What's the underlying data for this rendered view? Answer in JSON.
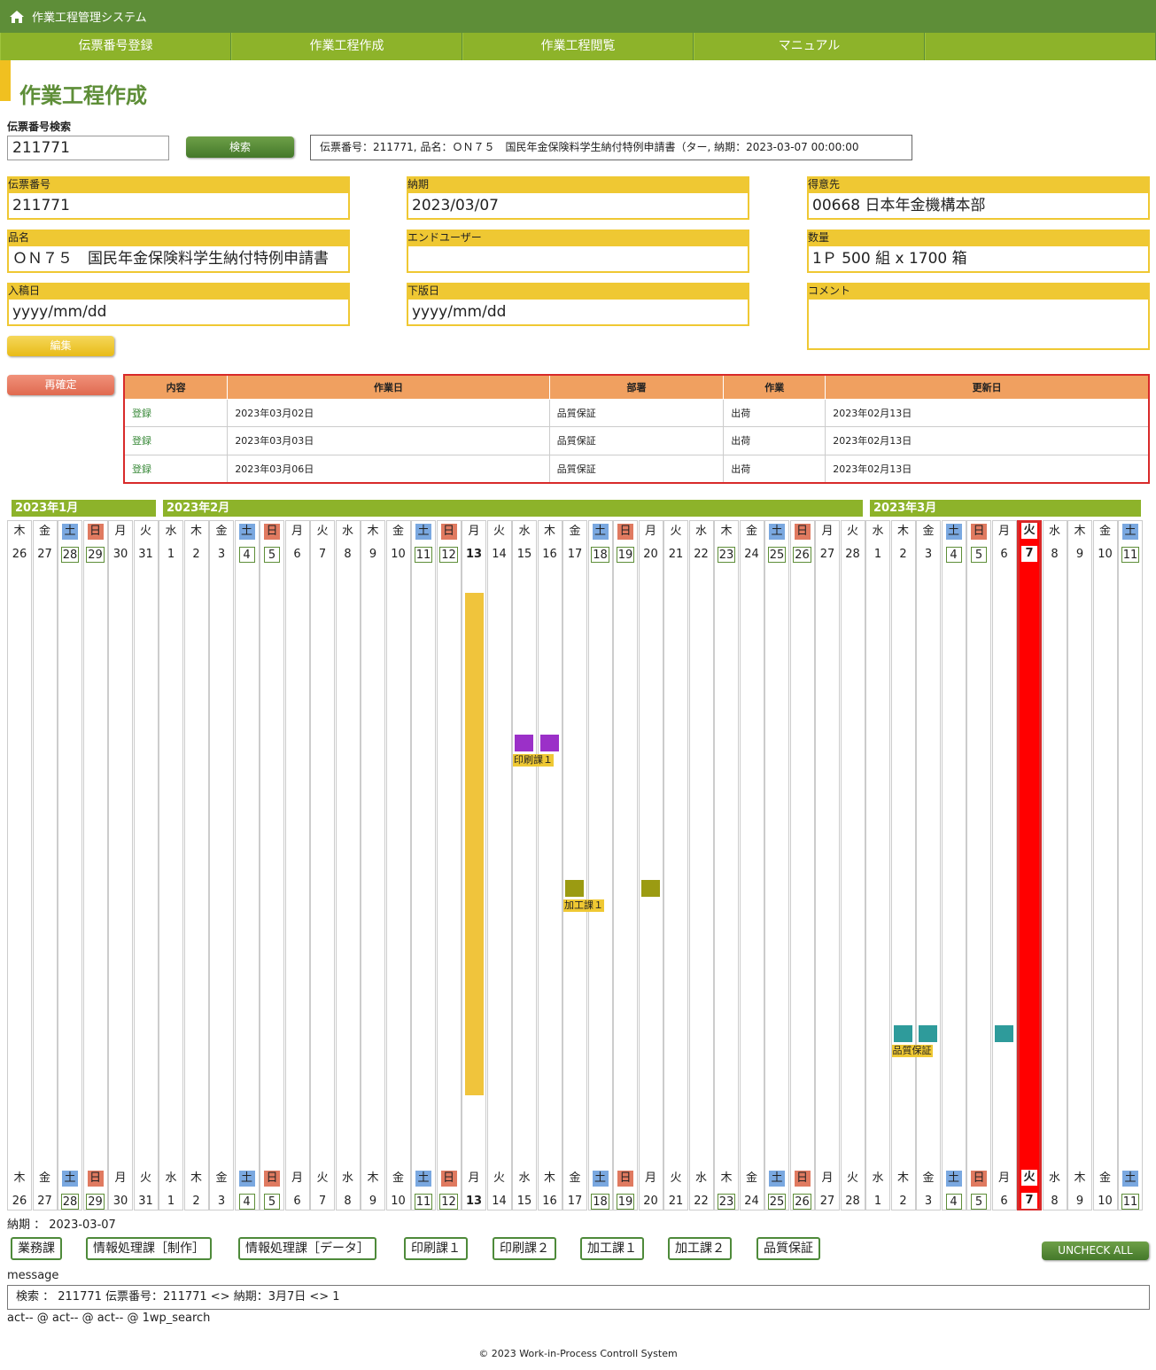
{
  "app": {
    "title": "作業工程管理システム"
  },
  "nav": [
    "伝票番号登録",
    "作業工程作成",
    "作業工程閲覧",
    "マニュアル",
    ""
  ],
  "page": {
    "title": "作業工程作成"
  },
  "search": {
    "label": "伝票番号検索",
    "value": "211771",
    "button": "検索",
    "result": "伝票番号：211771, 品名：ＯＮ７５　国民年金保険料学生納付特例申請書（ター, 納期：2023-03-07 00:00:00"
  },
  "form": {
    "slip_no": {
      "label": "伝票番号",
      "value": "211771"
    },
    "due": {
      "label": "納期",
      "value": "2023/03/07"
    },
    "customer": {
      "label": "得意先",
      "value": "00668 日本年金機構本部"
    },
    "product": {
      "label": "品名",
      "value": "ＯＮ７５　国民年金保険料学生納付特例申請書"
    },
    "end_user": {
      "label": "エンドユーザー",
      "value": ""
    },
    "quantity": {
      "label": "数量",
      "value": "1Ｐ 500 組 x 1700 箱"
    },
    "entry_date": {
      "label": "入稿日",
      "value": "yyyy/mm/dd"
    },
    "plate_date": {
      "label": "下版日",
      "value": "yyyy/mm/dd"
    },
    "comment": {
      "label": "コメント",
      "value": ""
    }
  },
  "buttons": {
    "edit": "編集",
    "reconfirm": "再確定",
    "uncheck_all": "UNCHECK ALL"
  },
  "history": {
    "headers": [
      "内容",
      "作業日",
      "部署",
      "作業",
      "更新日"
    ],
    "rows": [
      [
        "登録",
        "2023年03月02日",
        "品質保証",
        "出荷",
        "2023年02月13日"
      ],
      [
        "登録",
        "2023年03月03日",
        "品質保証",
        "出荷",
        "2023年02月13日"
      ],
      [
        "登録",
        "2023年03月06日",
        "品質保証",
        "出荷",
        "2023年02月13日"
      ]
    ]
  },
  "calendar": {
    "months": [
      {
        "label": "2023年1月",
        "first_day": 0,
        "days": 6
      },
      {
        "label": "2023年2月",
        "first_day": 6,
        "days": 28
      },
      {
        "label": "2023年3月",
        "first_day": 34,
        "days": 11
      }
    ],
    "days": [
      {
        "wd": "木",
        "d": "26"
      },
      {
        "wd": "金",
        "d": "27"
      },
      {
        "wd": "土",
        "d": "28",
        "t": "sat"
      },
      {
        "wd": "日",
        "d": "29",
        "t": "sun"
      },
      {
        "wd": "月",
        "d": "30"
      },
      {
        "wd": "火",
        "d": "31"
      },
      {
        "wd": "水",
        "d": "1"
      },
      {
        "wd": "木",
        "d": "2"
      },
      {
        "wd": "金",
        "d": "3"
      },
      {
        "wd": "土",
        "d": "4",
        "t": "sat"
      },
      {
        "wd": "日",
        "d": "5",
        "t": "sun"
      },
      {
        "wd": "月",
        "d": "6"
      },
      {
        "wd": "火",
        "d": "7"
      },
      {
        "wd": "水",
        "d": "8"
      },
      {
        "wd": "木",
        "d": "9"
      },
      {
        "wd": "金",
        "d": "10"
      },
      {
        "wd": "土",
        "d": "11",
        "t": "sat"
      },
      {
        "wd": "日",
        "d": "12",
        "t": "sun"
      },
      {
        "wd": "月",
        "d": "13",
        "bold": true
      },
      {
        "wd": "火",
        "d": "14"
      },
      {
        "wd": "水",
        "d": "15"
      },
      {
        "wd": "木",
        "d": "16"
      },
      {
        "wd": "金",
        "d": "17"
      },
      {
        "wd": "土",
        "d": "18",
        "t": "sat"
      },
      {
        "wd": "日",
        "d": "19",
        "t": "sun"
      },
      {
        "wd": "月",
        "d": "20"
      },
      {
        "wd": "火",
        "d": "21"
      },
      {
        "wd": "水",
        "d": "22"
      },
      {
        "wd": "木",
        "d": "23",
        "hol": true
      },
      {
        "wd": "金",
        "d": "24"
      },
      {
        "wd": "土",
        "d": "25",
        "t": "sat"
      },
      {
        "wd": "日",
        "d": "26",
        "t": "sun"
      },
      {
        "wd": "月",
        "d": "27"
      },
      {
        "wd": "火",
        "d": "28"
      },
      {
        "wd": "水",
        "d": "1"
      },
      {
        "wd": "木",
        "d": "2"
      },
      {
        "wd": "金",
        "d": "3"
      },
      {
        "wd": "土",
        "d": "4",
        "t": "sat"
      },
      {
        "wd": "日",
        "d": "5",
        "t": "sun"
      },
      {
        "wd": "月",
        "d": "6"
      },
      {
        "wd": "火",
        "d": "7",
        "today": true
      },
      {
        "wd": "水",
        "d": "8"
      },
      {
        "wd": "木",
        "d": "9"
      },
      {
        "wd": "金",
        "d": "10"
      },
      {
        "wd": "土",
        "d": "11",
        "t": "sat"
      }
    ],
    "tasks": [
      {
        "dept": "yellow",
        "label": "",
        "start": 18,
        "end": 18,
        "color": "#f0c43c"
      },
      {
        "dept": "印刷課１",
        "label": "印刷課１",
        "days": [
          20,
          21
        ],
        "color": "#9b30c8"
      },
      {
        "dept": "加工課１",
        "label": "加工課１",
        "days": [
          22,
          25
        ],
        "color": "#9b9b12"
      },
      {
        "dept": "品質保証",
        "label": "品質保証",
        "days": [
          35,
          36,
          39
        ],
        "color": "#2e9b9b"
      }
    ]
  },
  "due_line": "納期 ： 2023-03-07",
  "departments": [
    "業務課",
    "情報処理課［制作］",
    "情報処理課［データ］",
    "印刷課１",
    "印刷課２",
    "加工課１",
    "加工課２",
    "品質保証"
  ],
  "message": {
    "label": "message",
    "text": "検索 ： 211771 伝票番号：211771 <> 納期：3月7日 <> 1"
  },
  "act": "act-- @ act-- @ act-- @ 1wp_search",
  "footer": "© 2023 Work-in-Process Controll System",
  "colors": {
    "green": "#5e8e38",
    "lime": "#8db32a",
    "yellow": "#efc833",
    "red": "#d82a2a"
  }
}
